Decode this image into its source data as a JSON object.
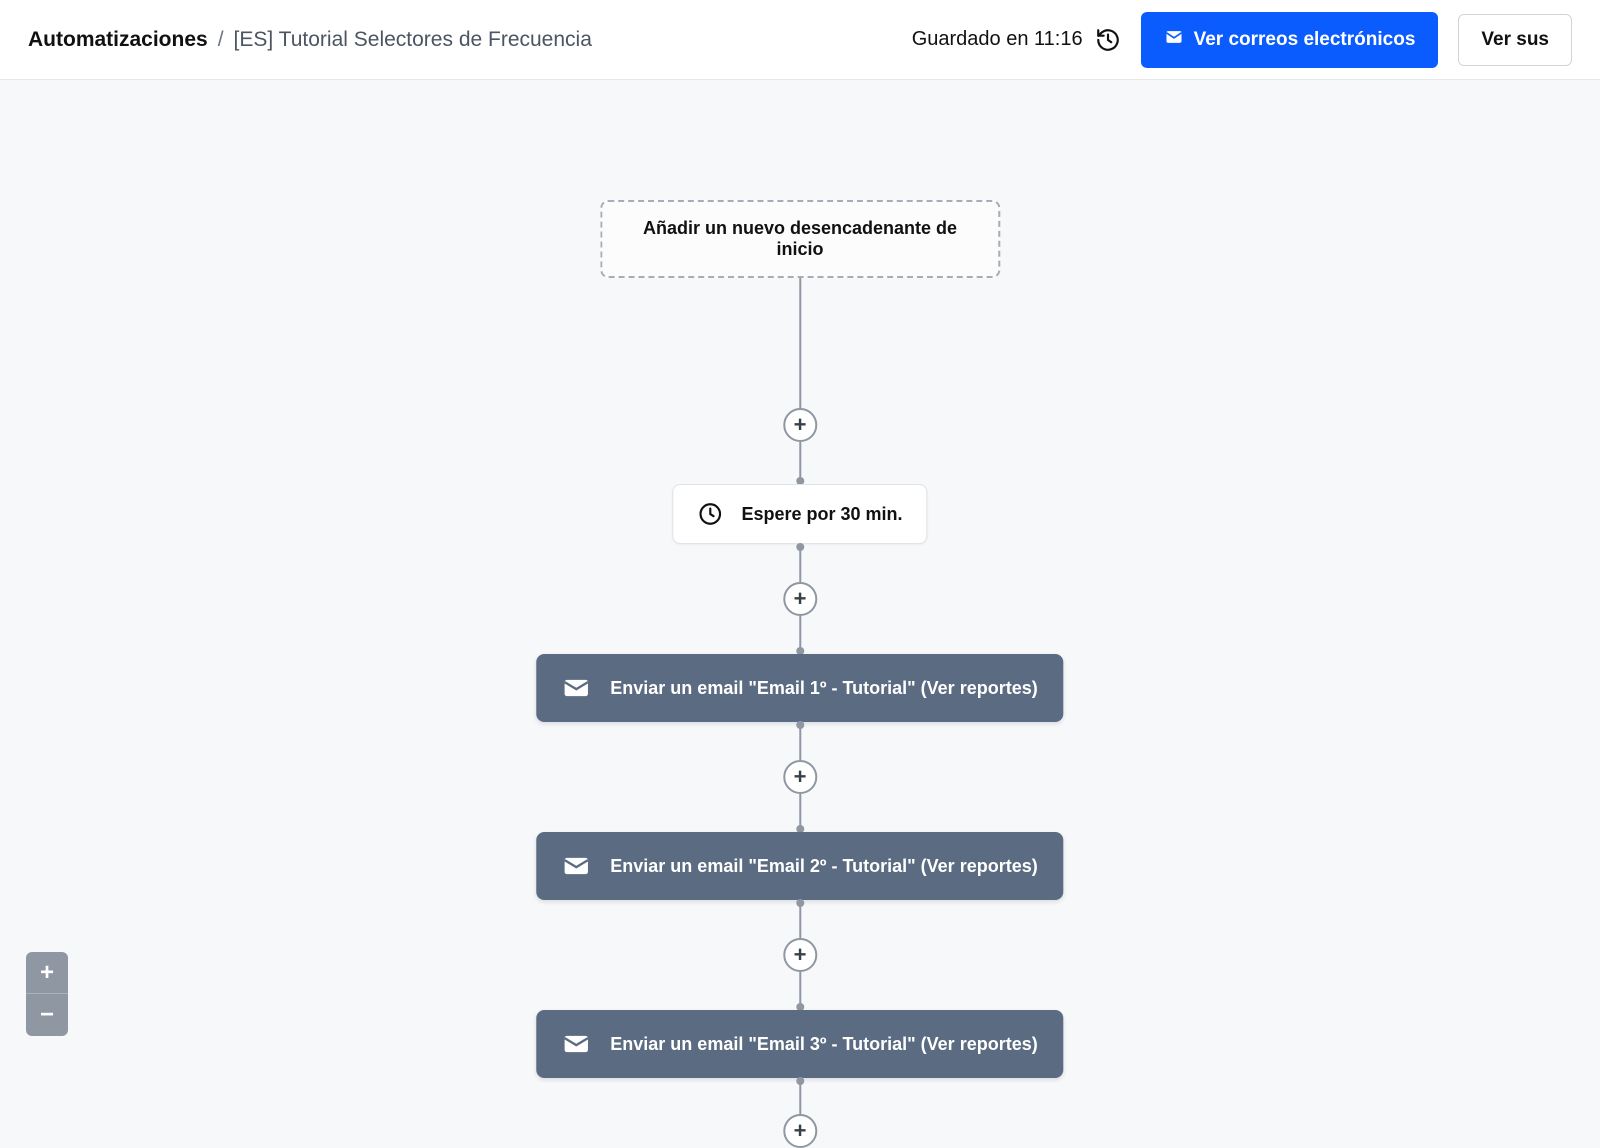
{
  "header": {
    "breadcrumb_root": "Automatizaciones",
    "breadcrumb_sep": "/",
    "breadcrumb_current": "[ES] Tutorial Selectores de Frecuencia",
    "saved_text": "Guardado en 11:16",
    "btn_view_emails": "Ver correos electrónicos",
    "btn_view_subs": "Ver sus"
  },
  "flow": {
    "trigger_placeholder": "Añadir un nuevo desencadenante de inicio",
    "wait_label": "Espere por 30 min.",
    "emails": [
      {
        "label": "Enviar un email \"Email 1º - Tutorial\" (Ver reportes)"
      },
      {
        "label": "Enviar un email \"Email 2º - Tutorial\" (Ver reportes)"
      },
      {
        "label": "Enviar un email \"Email 3º - Tutorial\" (Ver reportes)"
      }
    ],
    "plus": "+"
  },
  "zoom": {
    "in": "+",
    "out": "−"
  }
}
